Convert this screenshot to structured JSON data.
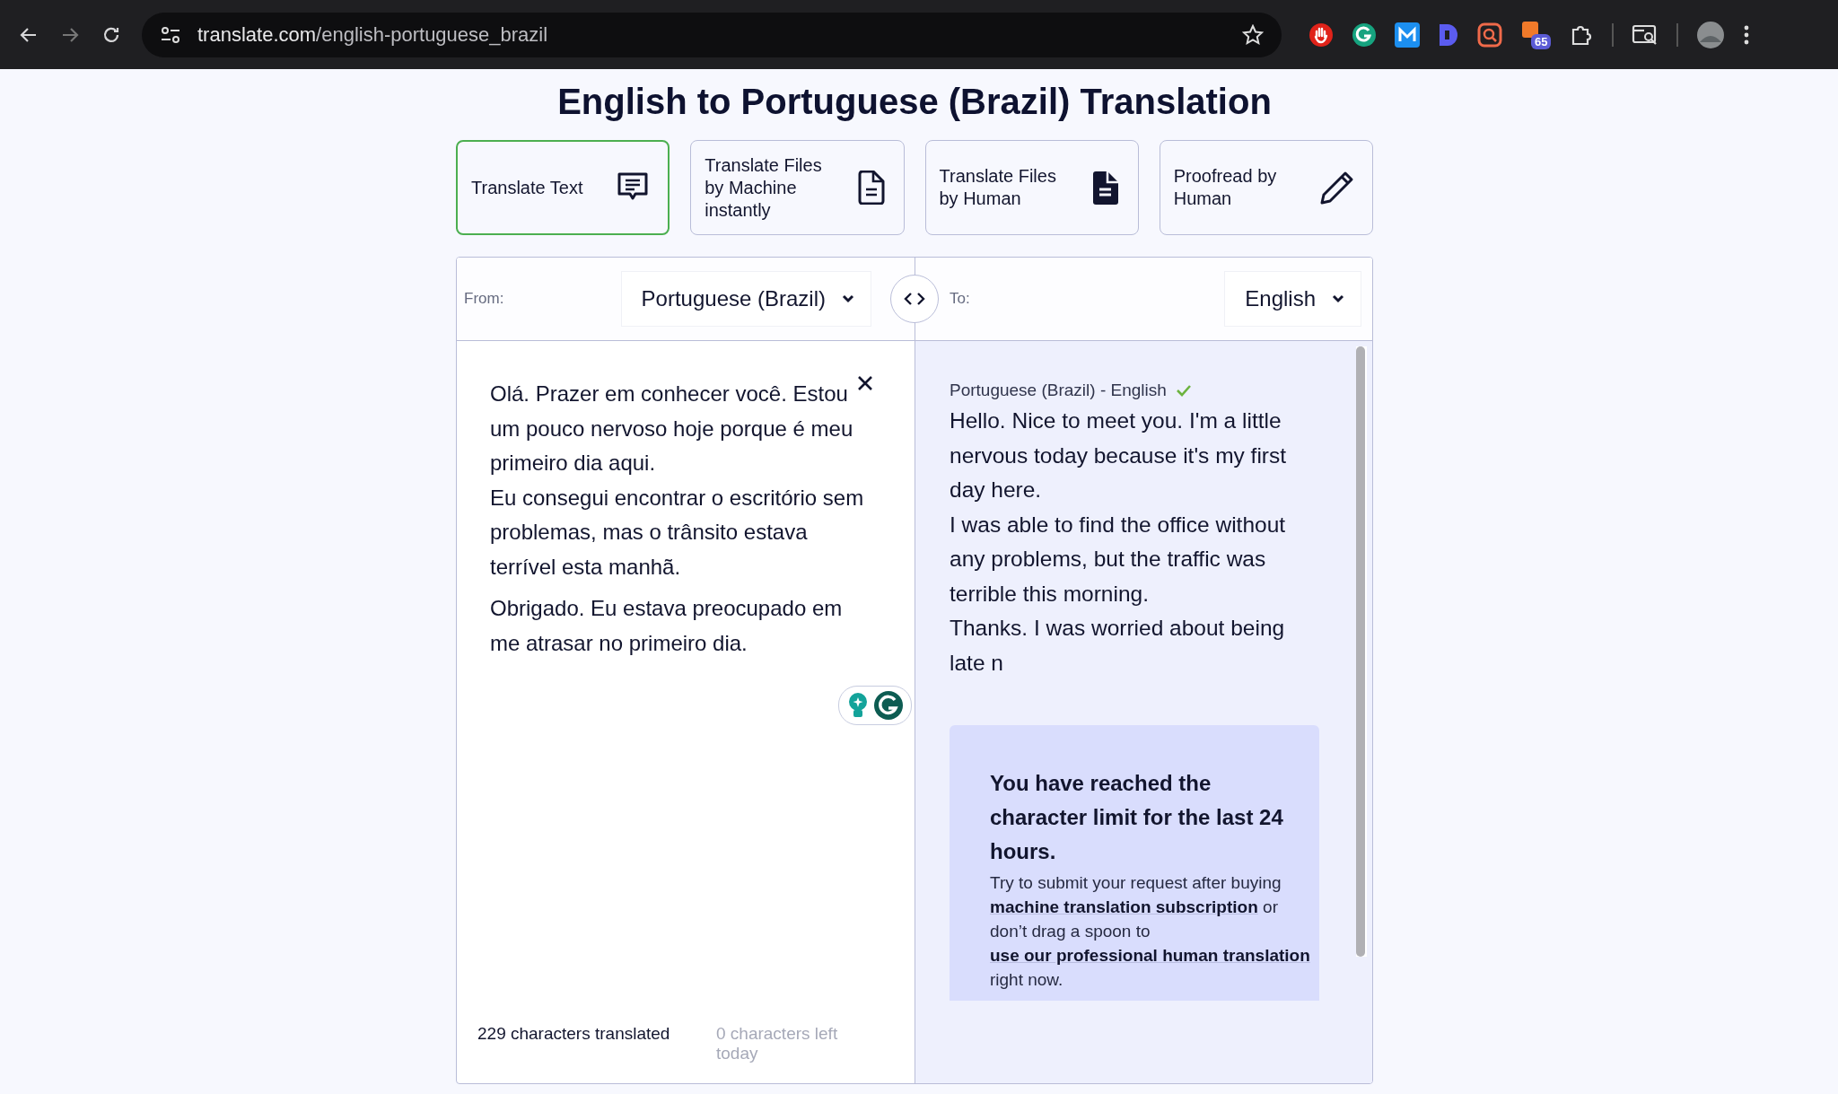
{
  "browser": {
    "url_host": "translate.com",
    "url_path": "/english-portuguese_brazil",
    "extension_badge": "65"
  },
  "title": "English to Portuguese (Brazil) Translation",
  "tabs": [
    {
      "label": "Translate Text",
      "kind": "chat",
      "selected": true
    },
    {
      "label": "Translate Files by Machine instantly",
      "kind": "doc",
      "selected": false
    },
    {
      "label": "Translate Files by Human",
      "kind": "filled",
      "selected": false
    },
    {
      "label": "Proofread by Human",
      "kind": "pencil",
      "selected": false
    }
  ],
  "from": {
    "label": "From:",
    "language": "Portuguese (Brazil)"
  },
  "to": {
    "label": "To:",
    "language": "English"
  },
  "source": {
    "paragraphs": [
      [
        "Olá. Prazer em conhecer você. Estou um pouco nervoso hoje porque é meu primeiro dia aqui.",
        "Eu consegui encontrar o escritório sem problemas, mas o trânsito estava terrível esta manhã."
      ],
      [
        "Obrigado. Eu estava preocupado em me atrasar no primeiro dia."
      ]
    ],
    "count": "229 characters translated",
    "left": "0 characters left today"
  },
  "result": {
    "pair": "Portuguese (Brazil) - English",
    "verified": true,
    "lines": [
      "Hello. Nice to meet you. I'm a little nervous today because it's my first day here.",
      "I was able to find the office without any problems, but the traffic was terrible this morning.",
      "Thanks. I was worried about being late n"
    ]
  },
  "notice": {
    "heading": "You have reached the character limit for the last 24 hours.",
    "parts": [
      {
        "kind": "text",
        "text": "Try to submit your request after buying "
      },
      {
        "kind": "link",
        "text": "machine translation subscription"
      },
      {
        "kind": "text",
        "text": " or don’t drag a spoon to "
      },
      {
        "kind": "link",
        "text": "use our professional human translation"
      },
      {
        "kind": "text",
        "text": " right now."
      }
    ]
  }
}
